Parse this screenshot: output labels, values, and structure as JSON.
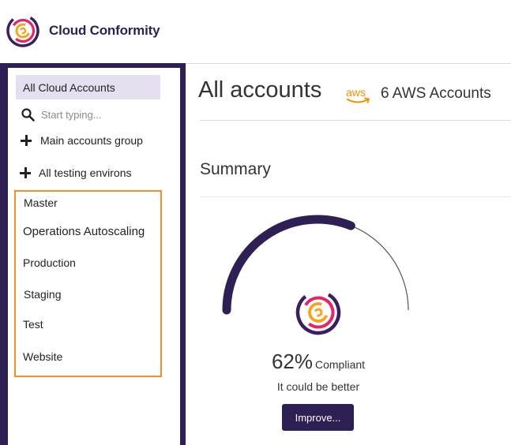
{
  "header": {
    "brand": "Cloud Conformity",
    "logo_icon": "cloud-conformity-logo-icon"
  },
  "sidebar": {
    "all_accounts_label": "All Cloud Accounts",
    "search": {
      "placeholder": "Start typing...",
      "value": ""
    },
    "groups": [
      {
        "label": "Main accounts group",
        "icon": "plus-icon"
      },
      {
        "label": "All testing environs",
        "icon": "plus-icon"
      }
    ],
    "accounts": [
      "Master",
      "Operations Autoscaling",
      "Production",
      "Staging",
      "Test",
      "Website"
    ]
  },
  "main": {
    "title": "All accounts",
    "aws_icon": "aws-logo-icon",
    "aws_count": "6 AWS Accounts",
    "summary_title": "Summary",
    "compliance": {
      "percent": 62,
      "percent_label": "62%",
      "status": "Compliant",
      "message": "It could be better",
      "button_label": "Improve..."
    }
  },
  "colors": {
    "brand_purple": "#2e1f55",
    "highlight": "#e6dff0",
    "group_outline": "#f28e2c",
    "aws_orange": "#f29100"
  }
}
